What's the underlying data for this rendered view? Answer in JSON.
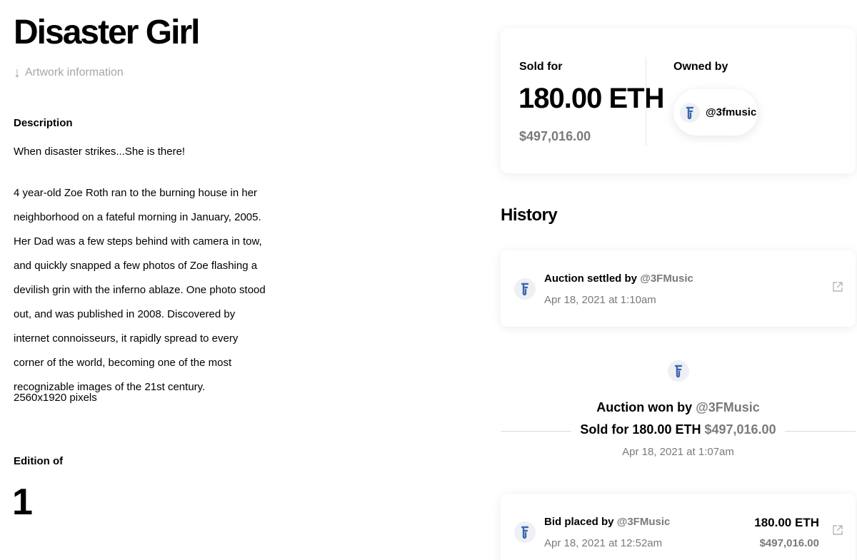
{
  "artwork": {
    "title": "Disaster Girl",
    "info_link": "Artwork information",
    "description_heading": "Description",
    "description_intro": "When disaster strikes...She is there!",
    "description_body": "4 year-old Zoe Roth ran to the burning house in her neighborhood on a fateful morning in January, 2005. Her Dad was a few steps behind with camera in tow, and quickly snapped a few photos of Zoe flashing a devilish grin with the inferno ablaze. One photo stood out, and was published in 2008. Discovered by internet connoisseurs, it rapidly spread to every corner of the world, becoming one of the most recognizable images of the 21st century.",
    "dimensions": "2560x1920 pixels",
    "edition_heading": "Edition of",
    "edition_count": "1"
  },
  "sale": {
    "sold_label": "Sold for",
    "price_eth": "180.00 ETH",
    "price_usd": "$497,016.00",
    "owned_label": "Owned by",
    "owner": "@3fmusic"
  },
  "history": {
    "heading": "History",
    "settled": {
      "action": "Auction settled by",
      "user": "@3FMusic",
      "date": "Apr 18, 2021 at 1:10am"
    },
    "won": {
      "action": "Auction won by",
      "user": "@3FMusic",
      "sold_text": "Sold for 180.00 ETH",
      "usd": "$497,016.00",
      "date": "Apr 18, 2021 at 1:07am"
    },
    "bid": {
      "action": "Bid placed by",
      "user": "@3FMusic",
      "date": "Apr 18, 2021 at 12:52am",
      "eth": "180.00 ETH",
      "usd": "$497,016.00"
    }
  },
  "colors": {
    "muted": "#7a7a7a",
    "avatar_bg": "#eef0f4",
    "avatar_glyph": "#3a67b0"
  },
  "icons": {
    "avatar": "3f-logo-icon",
    "external": "external-link-icon",
    "arrow": "arrow-down-icon"
  }
}
